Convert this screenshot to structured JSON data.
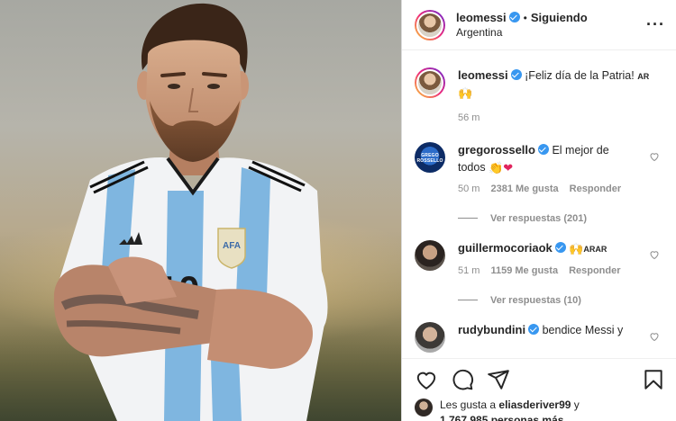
{
  "post": {
    "username": "leomessi",
    "dot": "•",
    "follow_status": "Siguiendo",
    "location": "Argentina",
    "more_icon": "more-horizontal-icon"
  },
  "photo": {
    "subject": "Messi in Argentina jersey with arms crossed",
    "jersey_number": "10",
    "badge_text": "AFA"
  },
  "caption": {
    "username": "leomessi",
    "text": "¡Feliz día de la Patria!",
    "tag": "AR",
    "emoji": "🙌",
    "time": "56 m"
  },
  "comments": [
    {
      "username": "gregorossello",
      "text_line1": "El mejor de",
      "text_line2": "todos",
      "emoji": "👏❤",
      "time": "50 m",
      "likes": "2381 Me gusta",
      "reply": "Responder",
      "replies": "Ver respuestas (201)",
      "avatar_text": "GREGO ROSSELLO"
    },
    {
      "username": "guillermocoriaok",
      "emoji": "🙌",
      "tag": "ARAR",
      "time": "51 m",
      "likes": "1159 Me gusta",
      "reply": "Responder",
      "replies": "Ver respuestas (10)"
    },
    {
      "username": "rudybundini",
      "text": "bendice Messi y"
    }
  ],
  "actions": {
    "like_icon": "heart-icon",
    "comment_icon": "comment-icon",
    "share_icon": "send-icon",
    "save_icon": "bookmark-icon"
  },
  "liked_by": {
    "prefix": "Les gusta a",
    "user": "eliasderiver99",
    "suffix": "y",
    "count": "1.767.985 personas más"
  },
  "colors": {
    "verified": "#3897f0",
    "text": "#262626",
    "muted": "#8e8e8e",
    "jersey_blue": "#7fb6e0"
  }
}
